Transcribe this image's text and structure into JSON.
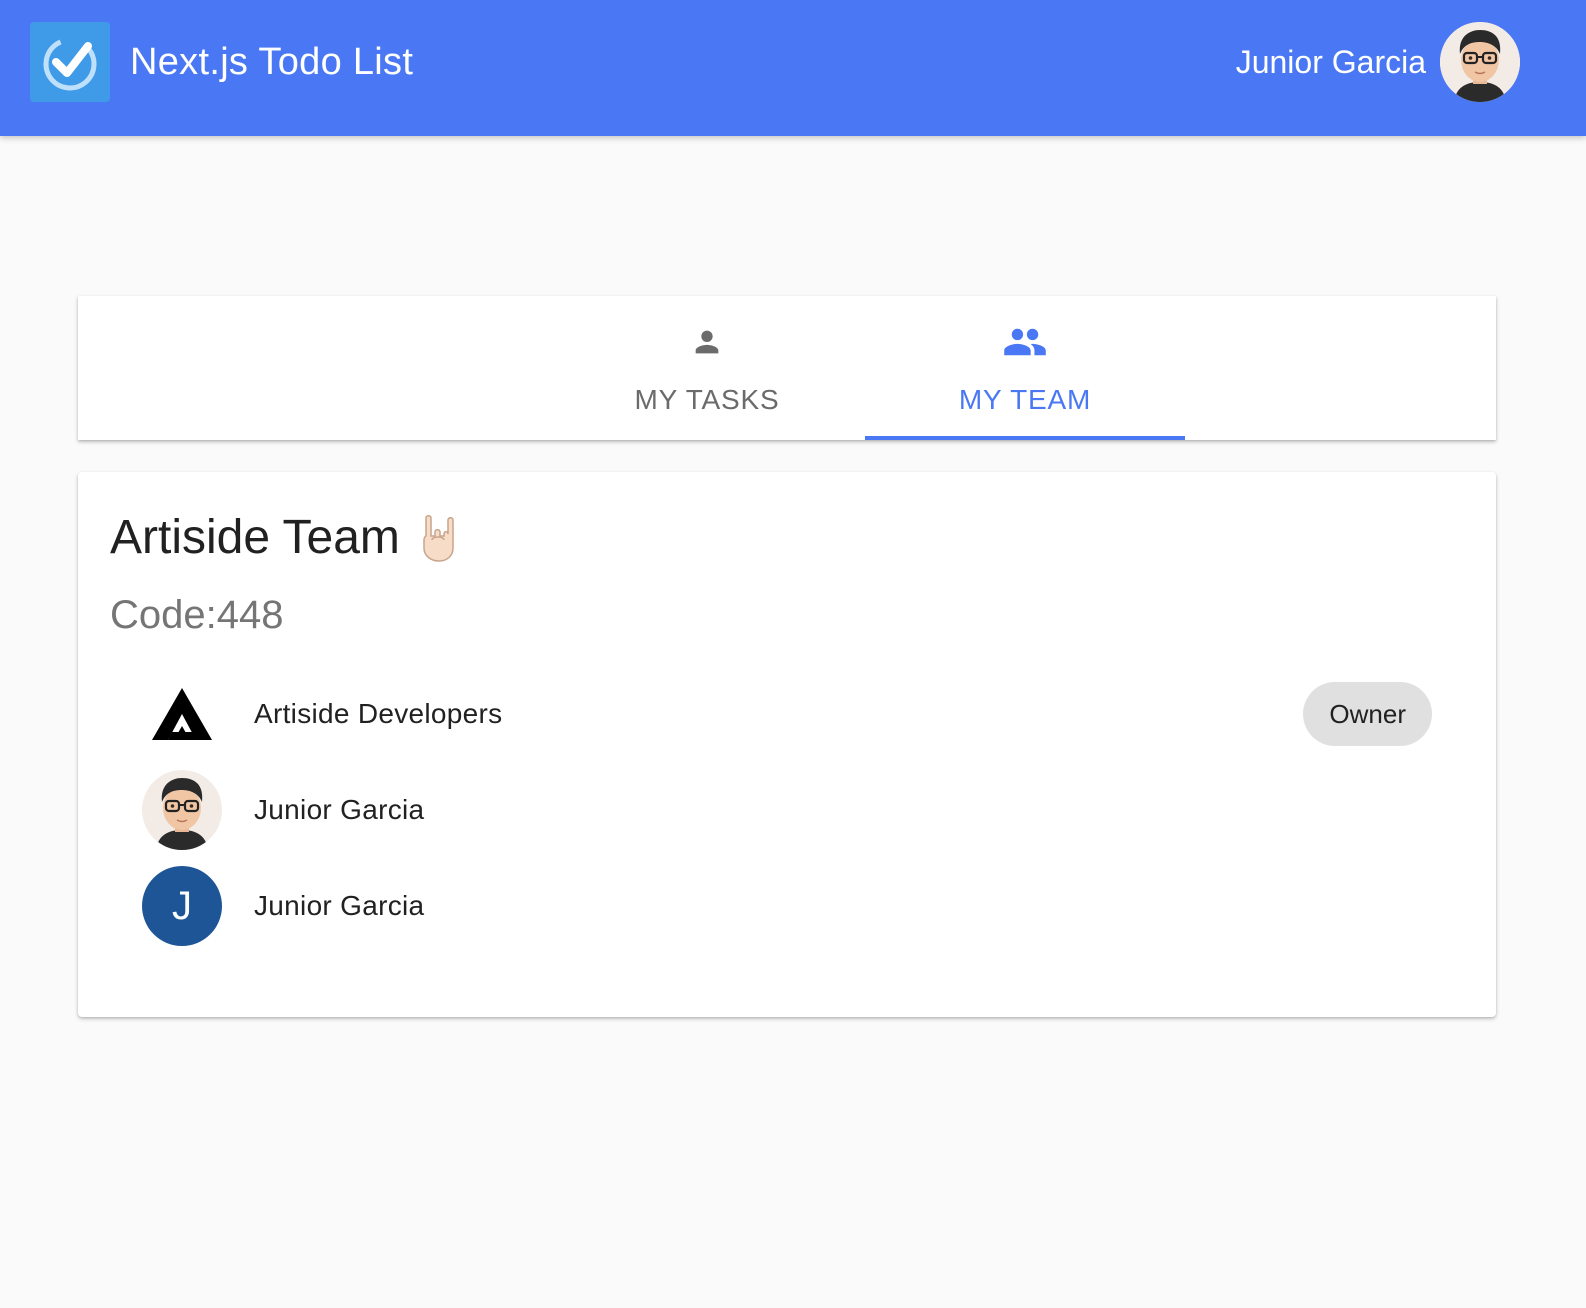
{
  "appbar": {
    "title": "Next.js Todo List",
    "user_name": "Junior Garcia",
    "logo_icon": "check-circle-icon",
    "color": "#4a78f5"
  },
  "tabs": [
    {
      "label": "MY TASKS",
      "icon": "person-icon",
      "selected": false
    },
    {
      "label": "MY TEAM",
      "icon": "people-icon",
      "selected": true
    }
  ],
  "team": {
    "name": "Artiside Team",
    "emoji_icon": "rock-on-hand-icon",
    "code_label": "Code:448",
    "members": [
      {
        "name": "Artiside Developers",
        "avatar": "artiside-logo-icon",
        "badge": "Owner"
      },
      {
        "name": "Junior Garcia",
        "avatar": "memoji-avatar"
      },
      {
        "name": "Junior Garcia",
        "avatar_letter": "J",
        "avatar_color": "#1e5596"
      }
    ]
  }
}
